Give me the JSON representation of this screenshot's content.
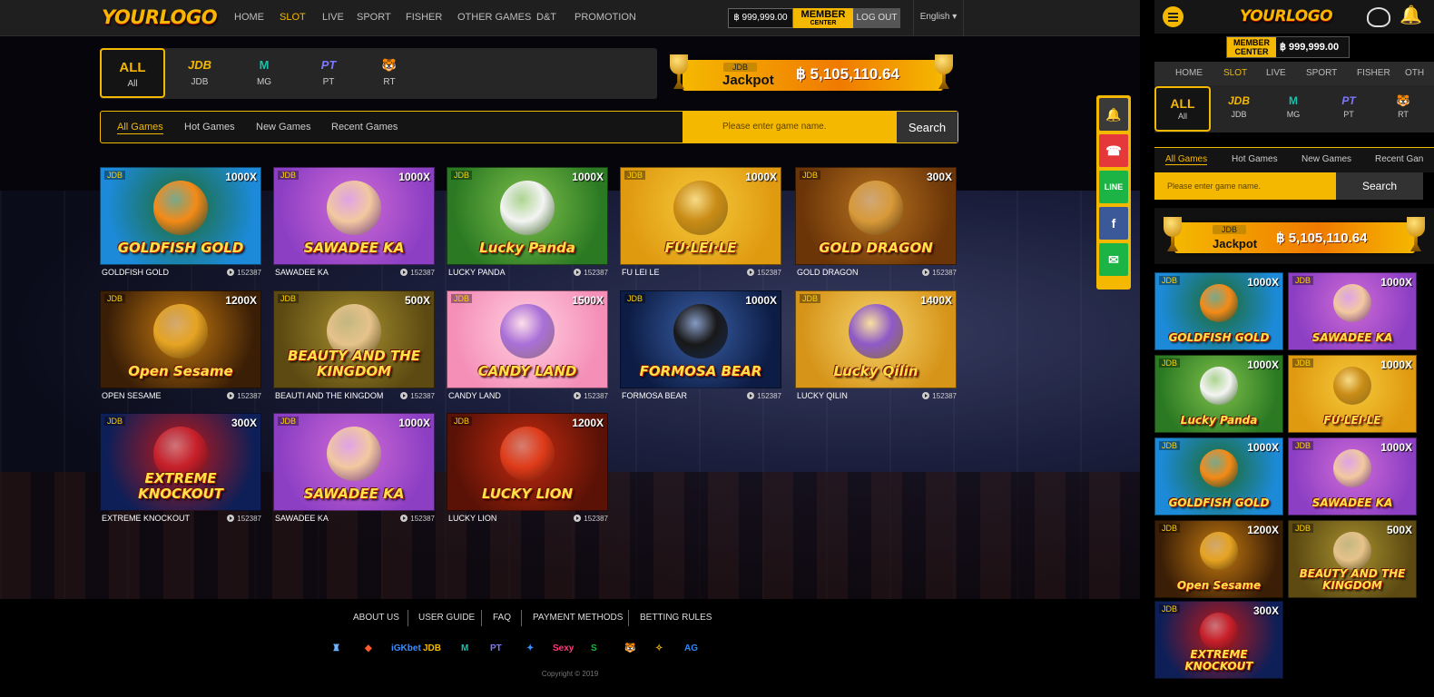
{
  "header": {
    "logo": "YOURLOGO",
    "nav": [
      "HOME",
      "SLOT",
      "LIVE",
      "SPORT",
      "FISHER",
      "OTHER GAMES",
      "D&T",
      "PROMOTION"
    ],
    "active_nav": "SLOT",
    "balance": "฿ 999,999.00",
    "member_line1": "MEMBER",
    "member_line2": "CENTER",
    "logout": "LOG OUT",
    "language": "English"
  },
  "providers": [
    {
      "icon": "ALL",
      "label": "All",
      "color": "#f5b800"
    },
    {
      "icon": "JDB",
      "label": "JDB",
      "color": "#f5b800"
    },
    {
      "icon": "M",
      "label": "MG",
      "color": "#19c1a8"
    },
    {
      "icon": "PT",
      "label": "PT",
      "color": "#7c78ff"
    },
    {
      "icon": "🐯",
      "label": "RT",
      "color": "#ffffff"
    }
  ],
  "jackpot": {
    "provider": "JDB",
    "label": "Jackpot",
    "amount": "฿ 5,105,110.64"
  },
  "tabs": [
    "All Games",
    "Hot Games",
    "New Games",
    "Recent Games"
  ],
  "search": {
    "placeholder": "Please enter game name.",
    "button": "Search"
  },
  "games": [
    {
      "name": "GOLDFISH GOLD",
      "art_title": "GOLDFISH GOLD",
      "provider": "JDB",
      "multiplier": "1000X",
      "plays": "152387",
      "bg": "#1c8ad9",
      "bg2": "#1e6b2a",
      "fig": "#f48a17"
    },
    {
      "name": "SAWADEE KA",
      "art_title": "SAWADEE KA",
      "provider": "JDB",
      "multiplier": "1000X",
      "plays": "152387",
      "bg": "#8d3fc4",
      "bg2": "#d06bd6",
      "fig": "#f2c9a0"
    },
    {
      "name": "LUCKY PANDA",
      "art_title": "Lucky Panda",
      "provider": "JDB",
      "multiplier": "1000X",
      "plays": "152387",
      "bg": "#2b7a23",
      "bg2": "#7fc04b",
      "fig": "#f4f4f4"
    },
    {
      "name": "FU LEI LE",
      "art_title": "FU·LEI·LE",
      "provider": "JDB",
      "multiplier": "1000X",
      "plays": "152387",
      "bg": "#e09a10",
      "bg2": "#f5c93b",
      "fig": "#c98b15"
    },
    {
      "name": "GOLD DRAGON",
      "art_title": "GOLD DRAGON",
      "provider": "JDB",
      "multiplier": "300X",
      "plays": "152387",
      "bg": "#6b3508",
      "bg2": "#b8731f",
      "fig": "#d89a3a"
    },
    {
      "name": "OPEN SESAME",
      "art_title": "Open Sesame",
      "provider": "JDB",
      "multiplier": "1200X",
      "plays": "152387",
      "bg": "#3a1e06",
      "bg2": "#c57a10",
      "fig": "#e6a423"
    },
    {
      "name": "BEAUTI AND THE KINGDOM",
      "art_title": "BEAUTY AND THE KINGDOM",
      "provider": "JDB",
      "multiplier": "500X",
      "plays": "152387",
      "bg": "#5c4a12",
      "bg2": "#a6902e",
      "fig": "#e6c38a"
    },
    {
      "name": "CANDY LAND",
      "art_title": "CANDY LAND",
      "provider": "JDB",
      "multiplier": "1500X",
      "plays": "152387",
      "bg": "#f58fb8",
      "bg2": "#ffd0e0",
      "fig": "#a970d8"
    },
    {
      "name": "FORMOSA BEAR",
      "art_title": "FORMOSA BEAR",
      "provider": "JDB",
      "multiplier": "1000X",
      "plays": "152387",
      "bg": "#0c1c44",
      "bg2": "#3a5fa6",
      "fig": "#181818"
    },
    {
      "name": "LUCKY QILIN",
      "art_title": "Lucky Qilin",
      "provider": "JDB",
      "multiplier": "1400X",
      "plays": "152387",
      "bg": "#d69419",
      "bg2": "#f5d36b",
      "fig": "#8e5ac8"
    },
    {
      "name": "EXTREME KNOCKOUT",
      "art_title": "EXTREME KNOCKOUT",
      "provider": "JDB",
      "multiplier": "300X",
      "plays": "152387",
      "bg": "#0e1f57",
      "bg2": "#c01818",
      "fig": "#c8202a"
    },
    {
      "name": "SAWADEE KA",
      "art_title": "SAWADEE KA",
      "provider": "JDB",
      "multiplier": "1000X",
      "plays": "152387",
      "bg": "#8d3fc4",
      "bg2": "#d06bd6",
      "fig": "#f2c9a0"
    },
    {
      "name": "LUCKY LION",
      "art_title": "LUCKY LION",
      "provider": "JDB",
      "multiplier": "1200X",
      "plays": "152387",
      "bg": "#5a1206",
      "bg2": "#c42a10",
      "fig": "#e03c1a"
    }
  ],
  "side_buttons": [
    {
      "icon": "bell-icon",
      "glyph": "🔔",
      "color": "#3a3a3a"
    },
    {
      "icon": "support-icon",
      "glyph": "☎",
      "color": "#e5383b"
    },
    {
      "icon": "line-icon",
      "glyph": "LINE",
      "color": "#1db446"
    },
    {
      "icon": "facebook-icon",
      "glyph": "f",
      "color": "#3b5998"
    },
    {
      "icon": "wechat-icon",
      "glyph": "✉",
      "color": "#1db446"
    }
  ],
  "footer": {
    "links": [
      "ABOUT US",
      "USER GUIDE",
      "FAQ",
      "PAYMENT METHODS",
      "BETTING RULES"
    ],
    "provider_logos": [
      {
        "t": "♜",
        "c": "#6fb7ff"
      },
      {
        "t": "◆",
        "c": "#ff5a2a"
      },
      {
        "t": "iGKbet",
        "c": "#3c8dff"
      },
      {
        "t": "JDB",
        "c": "#f5b800"
      },
      {
        "t": "M",
        "c": "#19c1a8"
      },
      {
        "t": "PT",
        "c": "#7c78ff"
      },
      {
        "t": "✦",
        "c": "#3c8dff"
      },
      {
        "t": "Sexy",
        "c": "#ff3a7a"
      },
      {
        "t": "S",
        "c": "#1db446"
      },
      {
        "t": "🐯",
        "c": "#ffffff"
      },
      {
        "t": "✧",
        "c": "#f5b800"
      },
      {
        "t": "AG",
        "c": "#2b8bff"
      }
    ],
    "copyright": "Copyright © 2019"
  },
  "mobile": {
    "nav": [
      "HOME",
      "SLOT",
      "LIVE",
      "SPORT",
      "FISHER",
      "OTH"
    ],
    "tabs": [
      "All Games",
      "Hot Games",
      "New Games",
      "Recent Gan"
    ],
    "games": [
      0,
      1,
      2,
      3,
      0,
      1,
      5,
      6,
      10
    ]
  }
}
